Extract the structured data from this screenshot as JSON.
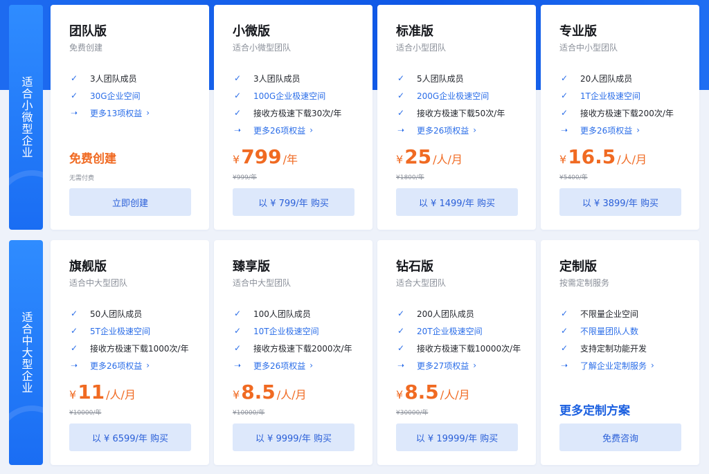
{
  "side_labels": [
    "适合小微型企业",
    "适合中大型企业"
  ],
  "cards": [
    {
      "title": "团队版",
      "subtitle": "免费创建",
      "features": [
        {
          "text": "3人团队成员",
          "icon": "check-icon",
          "style": "normal"
        },
        {
          "text": "30G企业空间",
          "icon": "check-icon",
          "style": "blue"
        },
        {
          "text": "更多13项权益",
          "icon": "arrow-right-icon",
          "style": "link"
        }
      ],
      "free_label": "免费创建",
      "original": "无需付费",
      "button": "立即创建"
    },
    {
      "title": "小微版",
      "subtitle": "适合小微型团队",
      "features": [
        {
          "text": "3人团队成员",
          "icon": "check-icon",
          "style": "normal"
        },
        {
          "text": "100G企业极速空间",
          "icon": "check-icon",
          "style": "blue"
        },
        {
          "text": "接收方极速下载30次/年",
          "icon": "check-icon",
          "style": "normal"
        },
        {
          "text": "更多26项权益",
          "icon": "arrow-right-icon",
          "style": "link"
        }
      ],
      "currency": "¥",
      "price": "799",
      "unit": "/年",
      "original": "¥999/年",
      "button": "以 ¥ 799/年 购买"
    },
    {
      "title": "标准版",
      "subtitle": "适合小型团队",
      "features": [
        {
          "text": "5人团队成员",
          "icon": "check-icon",
          "style": "normal"
        },
        {
          "text": "200G企业极速空间",
          "icon": "check-icon",
          "style": "blue"
        },
        {
          "text": "接收方极速下载50次/年",
          "icon": "check-icon",
          "style": "normal"
        },
        {
          "text": "更多26项权益",
          "icon": "arrow-right-icon",
          "style": "link"
        }
      ],
      "currency": "¥",
      "price": "25",
      "unit": "/人/月",
      "original": "¥1800/年",
      "button": "以 ¥ 1499/年 购买"
    },
    {
      "title": "专业版",
      "subtitle": "适合中小型团队",
      "features": [
        {
          "text": "20人团队成员",
          "icon": "check-icon",
          "style": "normal"
        },
        {
          "text": "1T企业极速空间",
          "icon": "check-icon",
          "style": "blue"
        },
        {
          "text": "接收方极速下载200次/年",
          "icon": "check-icon",
          "style": "normal"
        },
        {
          "text": "更多26项权益",
          "icon": "arrow-right-icon",
          "style": "link"
        }
      ],
      "currency": "¥",
      "price": "16.5",
      "unit": "/人/月",
      "original": "¥5400/年",
      "button": "以 ¥ 3899/年 购买"
    },
    {
      "title": "旗舰版",
      "subtitle": "适合中大型团队",
      "features": [
        {
          "text": "50人团队成员",
          "icon": "check-icon",
          "style": "normal"
        },
        {
          "text": "5T企业极速空间",
          "icon": "check-icon",
          "style": "blue"
        },
        {
          "text": "接收方极速下载1000次/年",
          "icon": "check-icon",
          "style": "normal"
        },
        {
          "text": "更多26项权益",
          "icon": "arrow-right-icon",
          "style": "link"
        }
      ],
      "currency": "¥",
      "price": "11",
      "unit": "/人/月",
      "original": "¥10000/年",
      "button": "以 ¥ 6599/年 购买"
    },
    {
      "title": "臻享版",
      "subtitle": "适合中大型团队",
      "features": [
        {
          "text": "100人团队成员",
          "icon": "check-icon",
          "style": "normal"
        },
        {
          "text": "10T企业极速空间",
          "icon": "check-icon",
          "style": "blue"
        },
        {
          "text": "接收方极速下载2000次/年",
          "icon": "check-icon",
          "style": "normal"
        },
        {
          "text": "更多26项权益",
          "icon": "arrow-right-icon",
          "style": "link"
        }
      ],
      "currency": "¥",
      "price": "8.5",
      "unit": "/人/月",
      "original": "¥10000/年",
      "button": "以 ¥ 9999/年 购买"
    },
    {
      "title": "钻石版",
      "subtitle": "适合大型团队",
      "features": [
        {
          "text": "200人团队成员",
          "icon": "check-icon",
          "style": "normal"
        },
        {
          "text": "20T企业极速空间",
          "icon": "check-icon",
          "style": "blue"
        },
        {
          "text": "接收方极速下载10000次/年",
          "icon": "check-icon",
          "style": "normal"
        },
        {
          "text": "更多27项权益",
          "icon": "arrow-right-icon",
          "style": "link"
        }
      ],
      "currency": "¥",
      "price": "8.5",
      "unit": "/人/月",
      "original": "¥30000/年",
      "button": "以 ¥ 19999/年 购买"
    },
    {
      "title": "定制版",
      "subtitle": "按需定制服务",
      "features": [
        {
          "text": "不限量企业空间",
          "icon": "check-icon",
          "style": "normal"
        },
        {
          "text": "不限量团队人数",
          "icon": "check-icon",
          "style": "blue"
        },
        {
          "text": "支持定制功能开发",
          "icon": "check-icon",
          "style": "normal"
        },
        {
          "text": "了解企业定制服务",
          "icon": "arrow-right-icon",
          "style": "link"
        }
      ],
      "custom_label": "更多定制方案",
      "button": "免费咨询"
    }
  ],
  "colors": {
    "accent": "#2a6de8",
    "price": "#f06a22",
    "button_bg": "#dde8fb",
    "header_bg": "#1660ea"
  }
}
